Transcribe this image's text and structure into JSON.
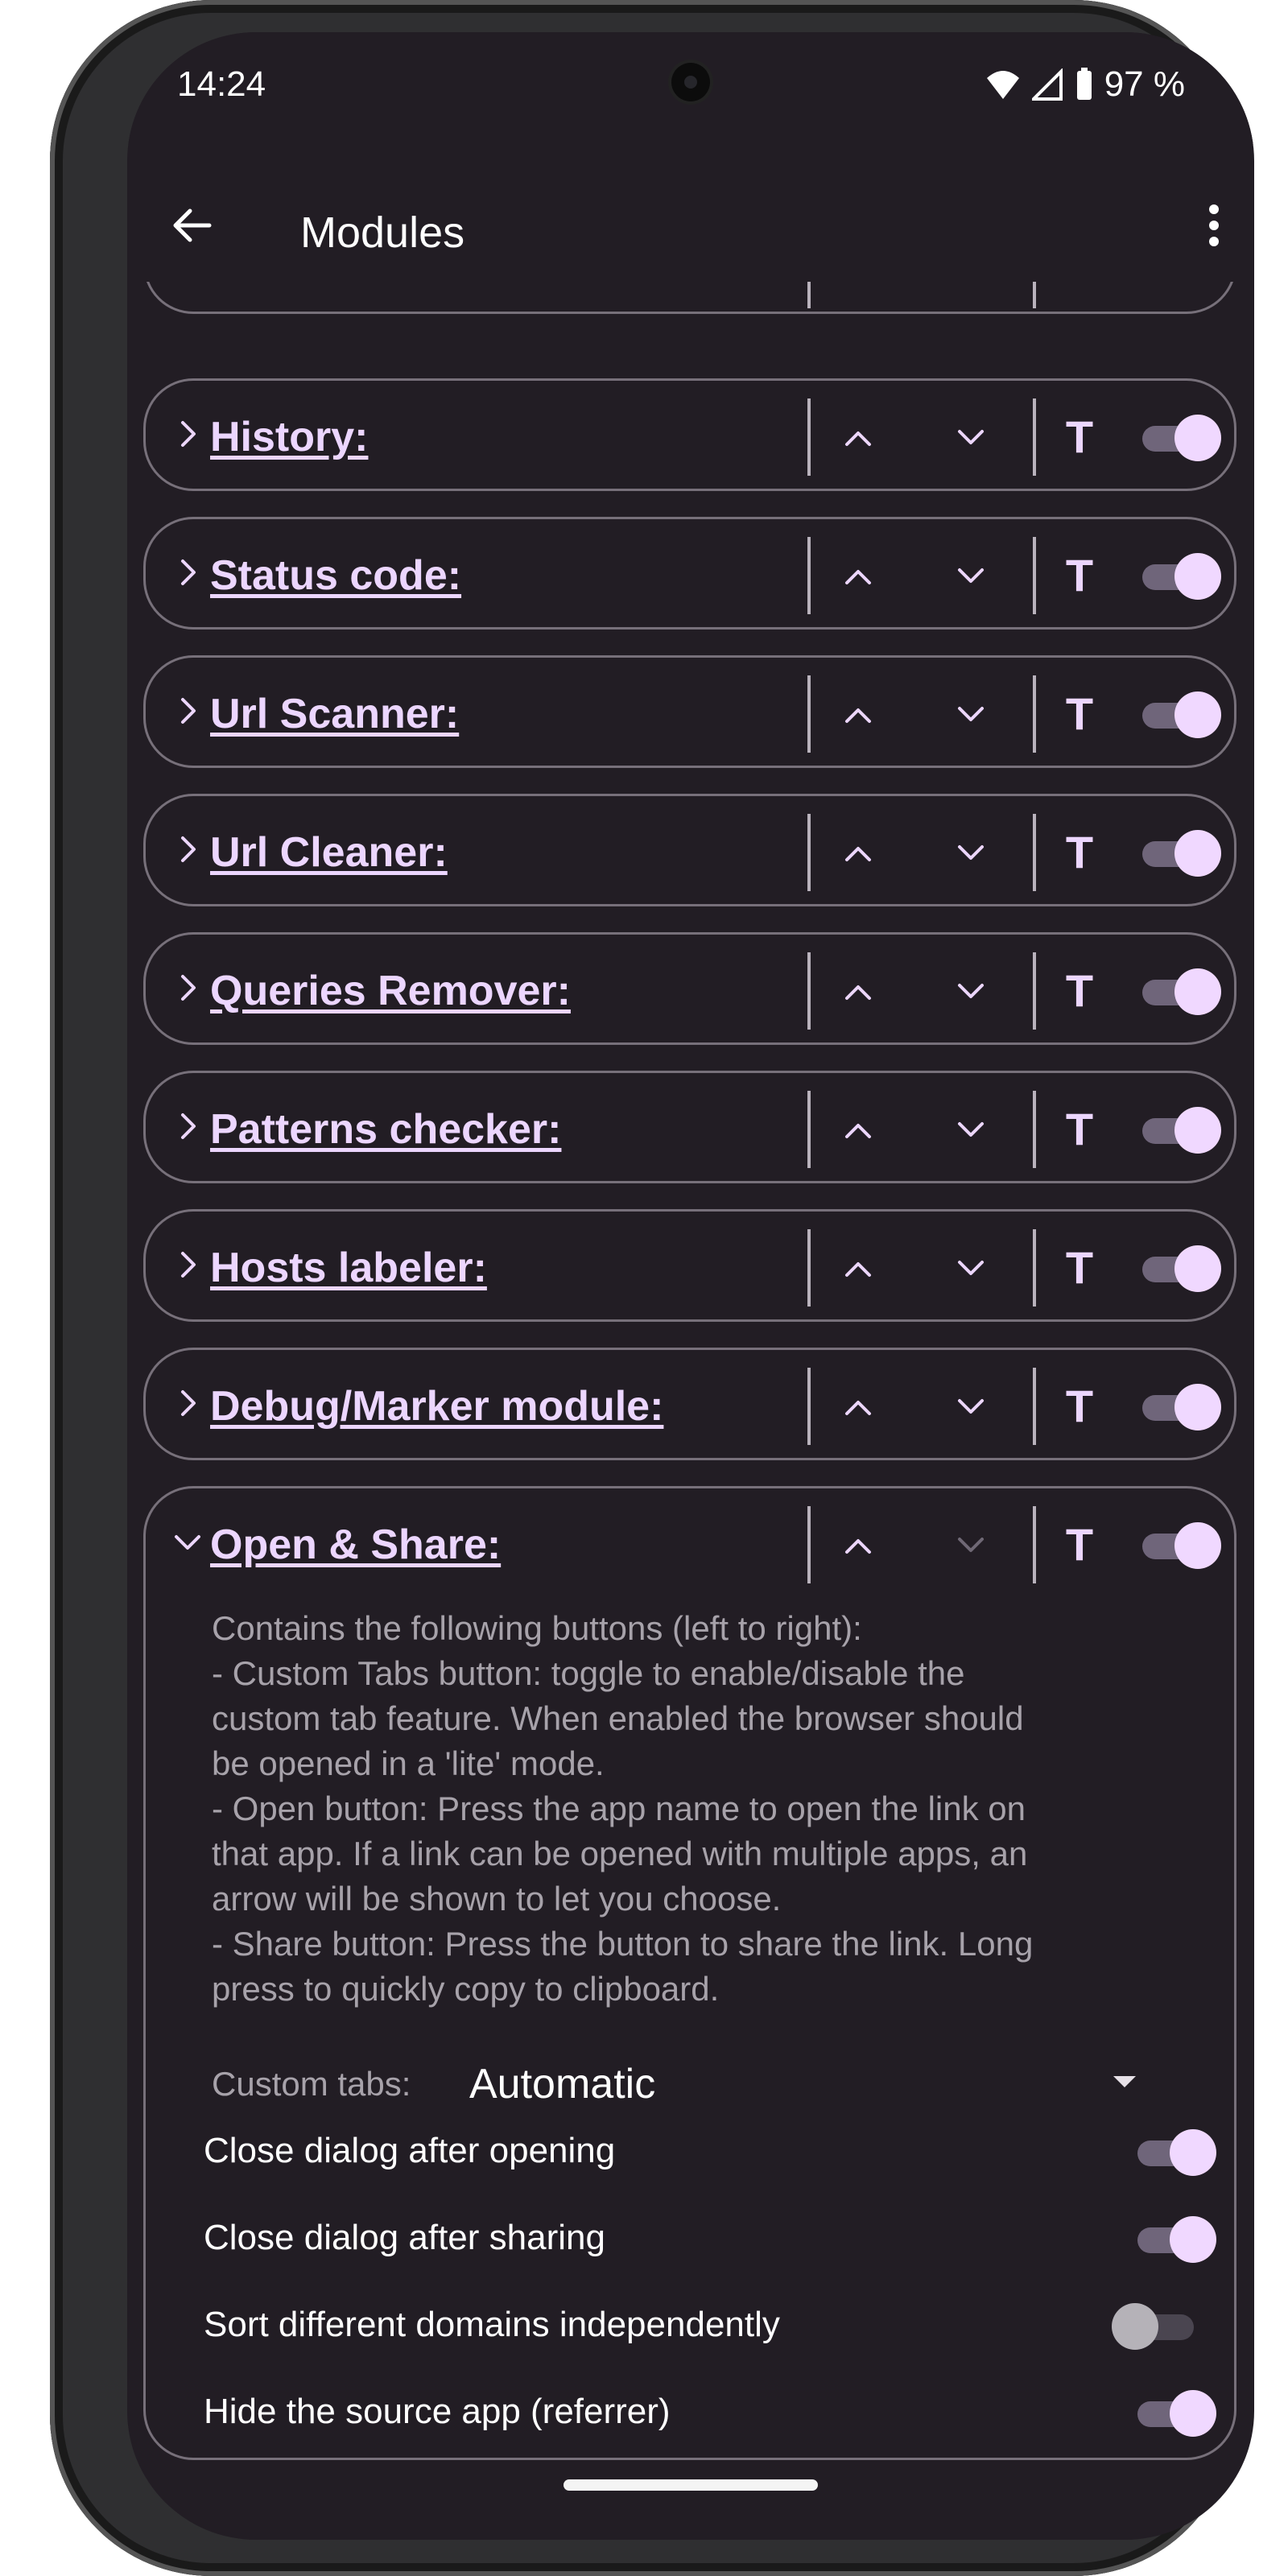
{
  "status_bar": {
    "time": "14:24",
    "battery": "97 %"
  },
  "app_bar": {
    "title": "Modules"
  },
  "colors": {
    "accent": "#ecd6ff",
    "background": "#221d24",
    "outline": "#77707a",
    "text_secondary": "#a7a2aa"
  },
  "modules": [
    {
      "title": "History:",
      "enabled": true,
      "expanded": false
    },
    {
      "title": "Status code:",
      "enabled": true,
      "expanded": false
    },
    {
      "title": "Url Scanner:",
      "enabled": true,
      "expanded": false
    },
    {
      "title": "Url Cleaner:",
      "enabled": true,
      "expanded": false
    },
    {
      "title": "Queries Remover:",
      "enabled": true,
      "expanded": false
    },
    {
      "title": "Patterns checker:",
      "enabled": true,
      "expanded": false
    },
    {
      "title": "Hosts labeler:",
      "enabled": true,
      "expanded": false
    },
    {
      "title": "Debug/Marker module:",
      "enabled": true,
      "expanded": false
    },
    {
      "title": "Open & Share:",
      "enabled": true,
      "expanded": true
    }
  ],
  "module_buttons": {
    "toggle_title_label": "T"
  },
  "open_share": {
    "description_lines": [
      "Contains the following buttons (left to right):",
      "- Custom Tabs button: toggle to enable/disable the",
      "custom tab feature. When enabled the browser should",
      "be opened in a 'lite' mode.",
      "- Open button: Press the app name to open the link on",
      "that app. If a link can be opened with multiple apps, an",
      "arrow will be shown to let you choose.",
      "- Share button: Press the button to share the link. Long",
      "press to quickly copy to clipboard."
    ],
    "custom_tabs": {
      "label": "Custom tabs:",
      "value": "Automatic"
    },
    "switches": [
      {
        "label": "Close dialog after opening",
        "on": true
      },
      {
        "label": "Close dialog after sharing",
        "on": true
      },
      {
        "label": "Sort different domains independently",
        "on": false
      },
      {
        "label": "Hide the source app (referrer)",
        "on": true
      }
    ]
  }
}
